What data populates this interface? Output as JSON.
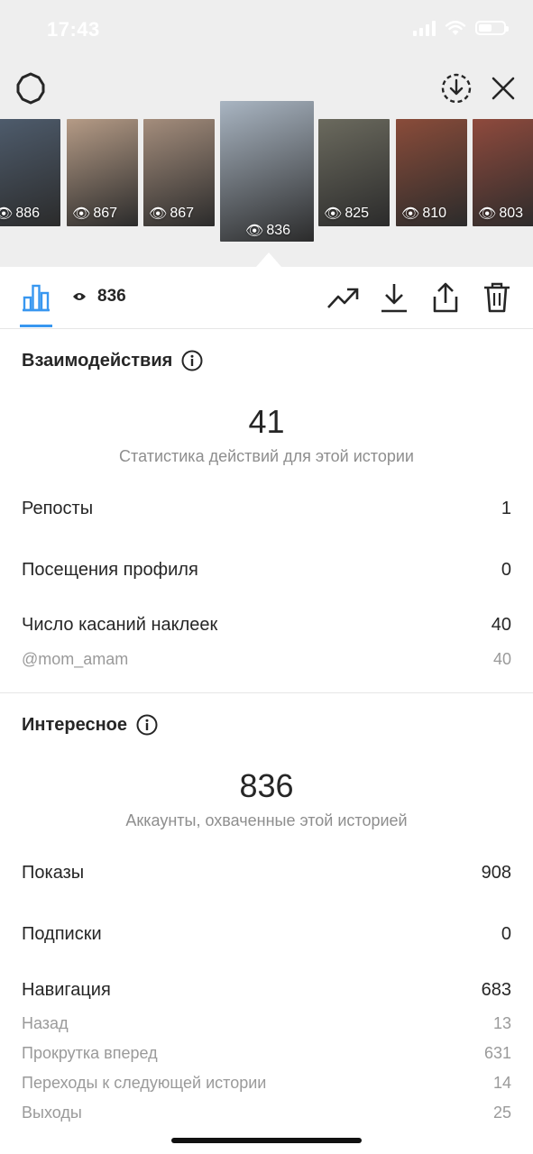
{
  "status_bar": {
    "time": "17:43"
  },
  "thumbnails": [
    {
      "views": "886",
      "bg": "#4f5d6e"
    },
    {
      "views": "867",
      "bg": "#b59b86"
    },
    {
      "views": "867",
      "bg": "#a48d7c"
    },
    {
      "views": "836",
      "bg": "#a9b5c2",
      "active": true
    },
    {
      "views": "825",
      "bg": "#6b6a5e"
    },
    {
      "views": "810",
      "bg": "#8a4c3a"
    },
    {
      "views": "803",
      "bg": "#8f4a3d"
    }
  ],
  "toolbar": {
    "views_count": "836"
  },
  "interactions": {
    "title": "Взаимодействия",
    "total": "41",
    "caption": "Статистика действий для этой истории",
    "rows": [
      {
        "label": "Репосты",
        "value": "1"
      },
      {
        "label": "Посещения профиля",
        "value": "0"
      },
      {
        "label": "Число касаний наклеек",
        "value": "40"
      }
    ],
    "sub_rows": [
      {
        "label": "@mom_amam",
        "value": "40"
      }
    ]
  },
  "discovery": {
    "title": "Интересное",
    "total": "836",
    "caption": "Аккаунты, охваченные этой историей",
    "rows": [
      {
        "label": "Показы",
        "value": "908"
      },
      {
        "label": "Подписки",
        "value": "0"
      },
      {
        "label": "Навигация",
        "value": "683"
      }
    ],
    "sub_rows": [
      {
        "label": "Назад",
        "value": "13"
      },
      {
        "label": "Прокрутка вперед",
        "value": "631"
      },
      {
        "label": "Переходы к следующей истории",
        "value": "14"
      },
      {
        "label": "Выходы",
        "value": "25"
      }
    ]
  },
  "colors": {
    "accent": "#3897f0",
    "text": "#262626",
    "muted": "#8e8e8e"
  }
}
